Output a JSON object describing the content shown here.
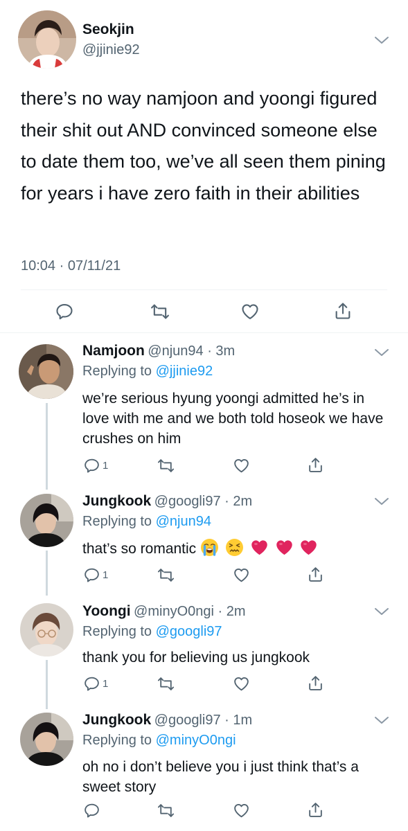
{
  "main_tweet": {
    "display_name": "Seokjin",
    "handle": "@jjinie92",
    "text": "there’s no way namjoon and yoongi figured their shit out AND convinced someone else to date them too, we’ve all seen them pining for years i have zero faith in their abilities",
    "timestamp": "10:04 · 07/11/21",
    "actions": [
      "reply-icon",
      "retweet-icon",
      "like-icon",
      "share-icon"
    ]
  },
  "replies": [
    {
      "display_name": "Namjoon",
      "meta": "@njun94 · 3m",
      "replying_prefix": "Replying to",
      "replying_to": "@jjinie92",
      "text": "we’re serious hyung yoongi admitted he’s in love with me and we both told hoseok we have crushes on him",
      "reply_count": "1"
    },
    {
      "display_name": "Jungkook",
      "meta": "@googli97 · 2m",
      "replying_prefix": "Replying to",
      "replying_to": "@njun94",
      "text": "that’s so romantic",
      "emojis": [
        "loudly-crying-face",
        "confounded-face",
        "red-heart",
        "red-heart",
        "red-heart"
      ],
      "reply_count": "1"
    },
    {
      "display_name": "Yoongi",
      "meta": "@minyO0ngi · 2m",
      "replying_prefix": "Replying to",
      "replying_to": "@googli97",
      "text": "thank you for believing us jungkook",
      "reply_count": "1"
    },
    {
      "display_name": "Jungkook",
      "meta": "@googli97 · 1m",
      "replying_prefix": "Replying to",
      "replying_to": "@minyO0ngi",
      "text": "oh no i don’t believe you i just think that’s a sweet story",
      "reply_count": ""
    }
  ],
  "colors": {
    "link": "#1d9bf0",
    "muted": "#536471",
    "divider": "#eff3f4",
    "heart": "#e0245e"
  }
}
